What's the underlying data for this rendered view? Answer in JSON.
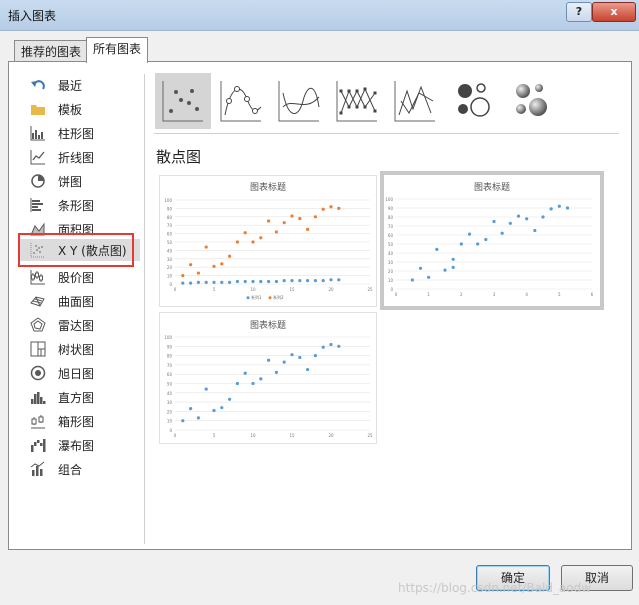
{
  "window": {
    "title": "插入图表",
    "help_label": "?",
    "close_label": "x"
  },
  "tabs": [
    {
      "label": "推荐的图表",
      "active": false
    },
    {
      "label": "所有图表",
      "active": true
    }
  ],
  "sidebar": {
    "items": [
      {
        "label": "最近",
        "icon": "undo-arrow-icon"
      },
      {
        "label": "模板",
        "icon": "folder-icon"
      },
      {
        "label": "柱形图",
        "icon": "column-chart-icon"
      },
      {
        "label": "折线图",
        "icon": "line-chart-icon"
      },
      {
        "label": "饼图",
        "icon": "pie-chart-icon"
      },
      {
        "label": "条形图",
        "icon": "bar-chart-icon"
      },
      {
        "label": "面积图",
        "icon": "area-chart-icon"
      },
      {
        "label": "X Y (散点图)",
        "icon": "scatter-chart-icon",
        "selected": true
      },
      {
        "label": "股价图",
        "icon": "stock-chart-icon"
      },
      {
        "label": "曲面图",
        "icon": "surface-chart-icon"
      },
      {
        "label": "雷达图",
        "icon": "radar-chart-icon"
      },
      {
        "label": "树状图",
        "icon": "treemap-chart-icon"
      },
      {
        "label": "旭日图",
        "icon": "sunburst-chart-icon"
      },
      {
        "label": "直方图",
        "icon": "histogram-chart-icon"
      },
      {
        "label": "箱形图",
        "icon": "box-whisker-chart-icon"
      },
      {
        "label": "瀑布图",
        "icon": "waterfall-chart-icon"
      },
      {
        "label": "组合",
        "icon": "combo-chart-icon"
      }
    ]
  },
  "subtypes": [
    {
      "name": "scatter",
      "icon": "scatter-subtype-icon",
      "selected": true
    },
    {
      "name": "scatter-smooth-markers",
      "icon": "scatter-smooth-markers-icon"
    },
    {
      "name": "scatter-smooth",
      "icon": "scatter-smooth-icon"
    },
    {
      "name": "scatter-straight-markers",
      "icon": "scatter-straight-markers-icon"
    },
    {
      "name": "scatter-straight",
      "icon": "scatter-straight-icon"
    },
    {
      "name": "bubble",
      "icon": "bubble-icon"
    },
    {
      "name": "bubble-3d",
      "icon": "bubble-3d-icon"
    }
  ],
  "section_heading": "散点图",
  "colors": {
    "series1": "#5b9bd5",
    "series2": "#ed7d31",
    "selection": "#e53935",
    "accent": "#3c7fb1"
  },
  "chart_data": [
    {
      "type": "scatter",
      "title": "图表标题",
      "xlim": [
        0,
        25
      ],
      "ylim": [
        0,
        100
      ],
      "xticks": [
        "0",
        "5",
        "10",
        "15",
        "20",
        "25"
      ],
      "yticks": [
        "0",
        "10",
        "20",
        "30",
        "40",
        "50",
        "60",
        "70",
        "80",
        "90",
        "100"
      ],
      "grid": true,
      "legend": "bottom",
      "series": [
        {
          "name": "系列1",
          "color": "#5b9bd5",
          "points": [
            [
              1,
              1
            ],
            [
              2,
              1
            ],
            [
              3,
              2
            ],
            [
              4,
              2
            ],
            [
              5,
              2
            ],
            [
              6,
              2
            ],
            [
              7,
              2
            ],
            [
              8,
              3
            ],
            [
              9,
              3
            ],
            [
              10,
              3
            ],
            [
              11,
              3
            ],
            [
              12,
              3
            ],
            [
              13,
              3
            ],
            [
              14,
              4
            ],
            [
              15,
              4
            ],
            [
              16,
              4
            ],
            [
              17,
              4
            ],
            [
              18,
              4
            ],
            [
              19,
              4
            ],
            [
              20,
              5
            ],
            [
              21,
              5
            ]
          ]
        },
        {
          "name": "系列2",
          "color": "#ed7d31",
          "points": [
            [
              1,
              10
            ],
            [
              2,
              23
            ],
            [
              3,
              13
            ],
            [
              4,
              44
            ],
            [
              5,
              21
            ],
            [
              6,
              24
            ],
            [
              7,
              33
            ],
            [
              8,
              50
            ],
            [
              9,
              61
            ],
            [
              10,
              50
            ],
            [
              11,
              55
            ],
            [
              12,
              75
            ],
            [
              13,
              62
            ],
            [
              14,
              73
            ],
            [
              15,
              81
            ],
            [
              16,
              78
            ],
            [
              17,
              65
            ],
            [
              18,
              80
            ],
            [
              19,
              89
            ],
            [
              20,
              92
            ],
            [
              21,
              90
            ]
          ]
        }
      ]
    },
    {
      "type": "scatter",
      "title": "图表标题",
      "xlim": [
        0,
        6
      ],
      "ylim": [
        0,
        100
      ],
      "xticks": [
        "0",
        "1",
        "2",
        "3",
        "4",
        "5",
        "6"
      ],
      "yticks": [
        "0",
        "10",
        "20",
        "30",
        "40",
        "50",
        "60",
        "70",
        "80",
        "90",
        "100"
      ],
      "grid": true,
      "series": [
        {
          "color": "#5b9bd5",
          "points": [
            [
              0.5,
              10
            ],
            [
              0.75,
              23
            ],
            [
              1,
              13
            ],
            [
              1.25,
              44
            ],
            [
              1.5,
              21
            ],
            [
              1.75,
              24
            ],
            [
              1.75,
              33
            ],
            [
              2,
              50
            ],
            [
              2.25,
              61
            ],
            [
              2.5,
              50
            ],
            [
              2.75,
              55
            ],
            [
              3,
              75
            ],
            [
              3.25,
              62
            ],
            [
              3.5,
              73
            ],
            [
              3.75,
              81
            ],
            [
              4,
              78
            ],
            [
              4.25,
              65
            ],
            [
              4.5,
              80
            ],
            [
              4.75,
              89
            ],
            [
              5,
              92
            ],
            [
              5.25,
              90
            ]
          ]
        }
      ]
    },
    {
      "type": "scatter",
      "title": "图表标题",
      "xlim": [
        0,
        25
      ],
      "ylim": [
        0,
        100
      ],
      "xticks": [
        "0",
        "5",
        "10",
        "15",
        "20",
        "25"
      ],
      "yticks": [
        "0",
        "10",
        "20",
        "30",
        "40",
        "50",
        "60",
        "70",
        "80",
        "90",
        "100"
      ],
      "grid": true,
      "series": [
        {
          "color": "#5b9bd5",
          "points": [
            [
              1,
              10
            ],
            [
              2,
              23
            ],
            [
              3,
              13
            ],
            [
              4,
              44
            ],
            [
              5,
              21
            ],
            [
              6,
              24
            ],
            [
              7,
              33
            ],
            [
              8,
              50
            ],
            [
              9,
              61
            ],
            [
              10,
              50
            ],
            [
              11,
              55
            ],
            [
              12,
              75
            ],
            [
              13,
              62
            ],
            [
              14,
              73
            ],
            [
              15,
              81
            ],
            [
              16,
              78
            ],
            [
              17,
              65
            ],
            [
              18,
              80
            ],
            [
              19,
              89
            ],
            [
              20,
              92
            ],
            [
              21,
              90
            ]
          ]
        }
      ]
    }
  ],
  "buttons": {
    "ok_label": "确定",
    "cancel_label": "取消"
  },
  "watermark": "https://blog.csdn.net/Bald_aodw"
}
